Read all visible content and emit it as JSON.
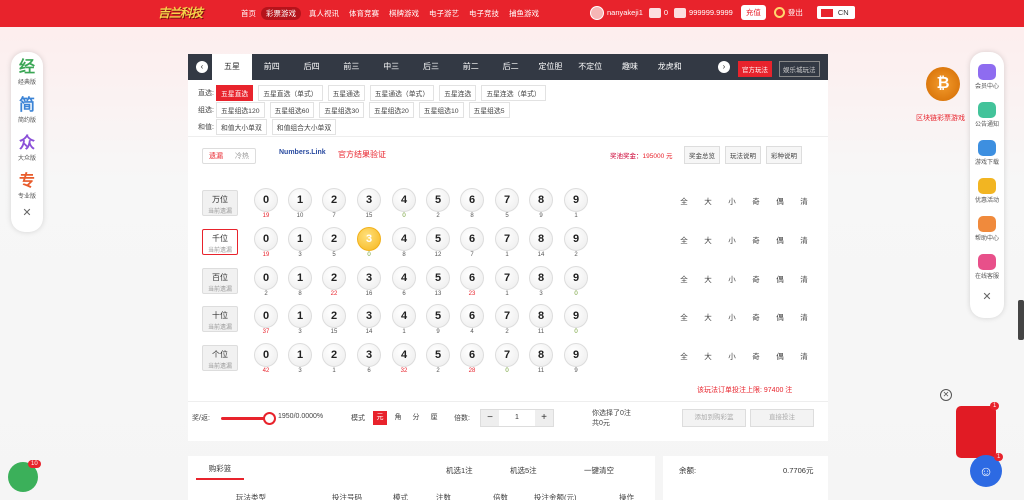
{
  "header": {
    "logo": "吉兰科技",
    "nav": [
      "首页",
      "彩票游戏",
      "真人视讯",
      "体育竞赛",
      "棋牌游戏",
      "电子游艺",
      "电子竞技",
      "捕鱼游戏"
    ],
    "nav_active": 1,
    "username": "nanyakeji1",
    "messages": "0",
    "balance": "999999.9999",
    "recharge": "充值",
    "logout": "登出",
    "lang": "CN"
  },
  "left_side": {
    "items": [
      {
        "glyph": "经",
        "label": "经典版"
      },
      {
        "glyph": "简",
        "label": "简约版"
      },
      {
        "glyph": "众",
        "label": "大众版"
      },
      {
        "glyph": "专",
        "label": "专业版"
      }
    ],
    "close": "✕"
  },
  "right_side": {
    "items": [
      "会员中心",
      "公告通知",
      "游戏下载",
      "优惠活动",
      "帮助中心",
      "在线客服"
    ],
    "close": "✕"
  },
  "tabs": {
    "items": [
      "五星",
      "前四",
      "后四",
      "前三",
      "中三",
      "后三",
      "前二",
      "后二",
      "定位胆",
      "不定位",
      "趣味",
      "龙虎和"
    ],
    "active": 0,
    "prev": "‹",
    "next": "›",
    "mode_official": "官方玩法",
    "mode_credit": "娱乐城玩法"
  },
  "rows": [
    {
      "label": "直选:",
      "chips": [
        "五星直选",
        "五星直选（单式）",
        "五星通选",
        "五星通选（单式）",
        "五星连选",
        "五星连选（单式）"
      ],
      "active": 0
    },
    {
      "label": "组选:",
      "chips": [
        "五星组选120",
        "五星组选60",
        "五星组选30",
        "五星组选20",
        "五星组选10",
        "五星组选5"
      ],
      "active": -1
    },
    {
      "label": "和值:",
      "chips": [
        "和值大小单双",
        "和值组合大小单双"
      ],
      "active": -1
    }
  ],
  "toggle": [
    "遗漏",
    "冷热"
  ],
  "numbers_link": "Numbers.Link",
  "verify": "官方结果验证",
  "jackpot": {
    "label": "奖池奖金：",
    "value": "195000 元"
  },
  "right_buttons": [
    "奖金总览",
    "玩法说明",
    "彩种说明"
  ],
  "positions": [
    {
      "name": "万位",
      "sub": "当前遗漏",
      "miss": [
        "19",
        "10",
        "7",
        "15",
        "0",
        "2",
        "8",
        "5",
        "9",
        "1"
      ],
      "sel": -1,
      "active": false
    },
    {
      "name": "千位",
      "sub": "当前遗漏",
      "miss": [
        "19",
        "3",
        "5",
        "0",
        "8",
        "12",
        "7",
        "1",
        "14",
        "2"
      ],
      "sel": 3,
      "active": true
    },
    {
      "name": "百位",
      "sub": "当前遗漏",
      "miss": [
        "2",
        "8",
        "22",
        "16",
        "6",
        "13",
        "23",
        "1",
        "3",
        "0"
      ],
      "sel": -1,
      "active": false
    },
    {
      "name": "十位",
      "sub": "当前遗漏",
      "miss": [
        "37",
        "3",
        "15",
        "14",
        "1",
        "9",
        "4",
        "2",
        "11",
        "0"
      ],
      "sel": -1,
      "active": false
    },
    {
      "name": "个位",
      "sub": "当前遗漏",
      "miss": [
        "42",
        "3",
        "1",
        "6",
        "32",
        "2",
        "28",
        "0",
        "11",
        "9"
      ],
      "sel": -1,
      "active": false
    }
  ],
  "filters": [
    "全",
    "大",
    "小",
    "奇",
    "偶",
    "清"
  ],
  "limit_text": "该玩法订单投注上限: 97400 注",
  "bottom": {
    "rebate_label": "奖/返:",
    "rebate_value": "1950/0.0000%",
    "mode_label": "模式",
    "modes": [
      "元",
      "角",
      "分",
      "厘"
    ],
    "mode_active": 0,
    "multiple_label": "倍数:",
    "multiple": "1",
    "selected": "你选择了0注",
    "total": "共0元",
    "add_btn": "添加到购彩篮",
    "buy_btn": "直接投注"
  },
  "cart": {
    "title": "购彩篮",
    "actions": [
      "机选1注",
      "机选5注",
      "一键清空"
    ],
    "headers": [
      "玩法类型",
      "投注号码",
      "模式",
      "注数",
      "倍数",
      "投注金额(元)",
      "操作"
    ]
  },
  "balance_box": {
    "label": "余额:",
    "value": "0.7706元"
  },
  "promo": {
    "coin": "₿",
    "text": "区块链彩票游戏"
  },
  "redpacket_badge": "1",
  "chat_badge": "10"
}
